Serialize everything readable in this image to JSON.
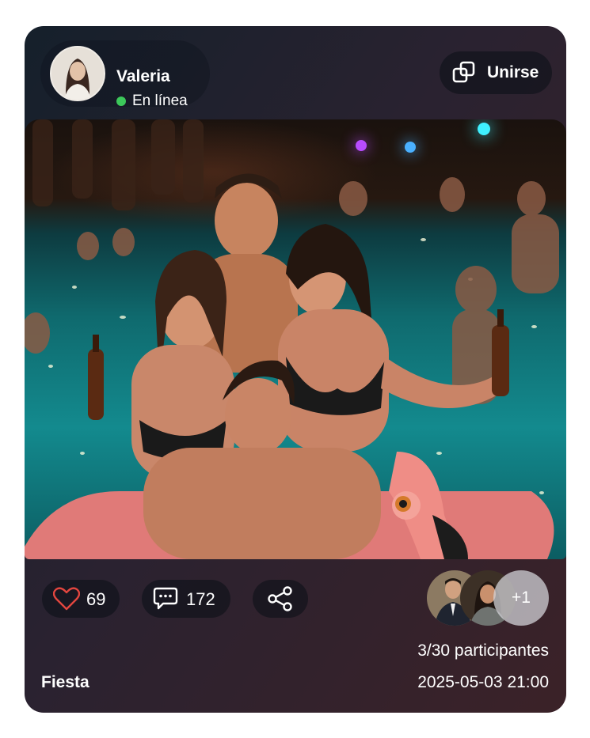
{
  "post": {
    "user": {
      "name": "Valeria",
      "status": "En línea"
    },
    "join_label": "Unirse",
    "likes": "69",
    "comments": "172",
    "extra_participants": "+1",
    "participants_text": "3/30 participantes",
    "category": "Fiesta",
    "datetime": "2025-05-03 21:00"
  },
  "icons": {
    "like": "heart-icon",
    "comment": "comment-icon",
    "share": "share-icon",
    "join": "copy-icon"
  },
  "colors": {
    "online": "#3cc85a",
    "heart": "#e2463f",
    "text": "#ffffff"
  }
}
